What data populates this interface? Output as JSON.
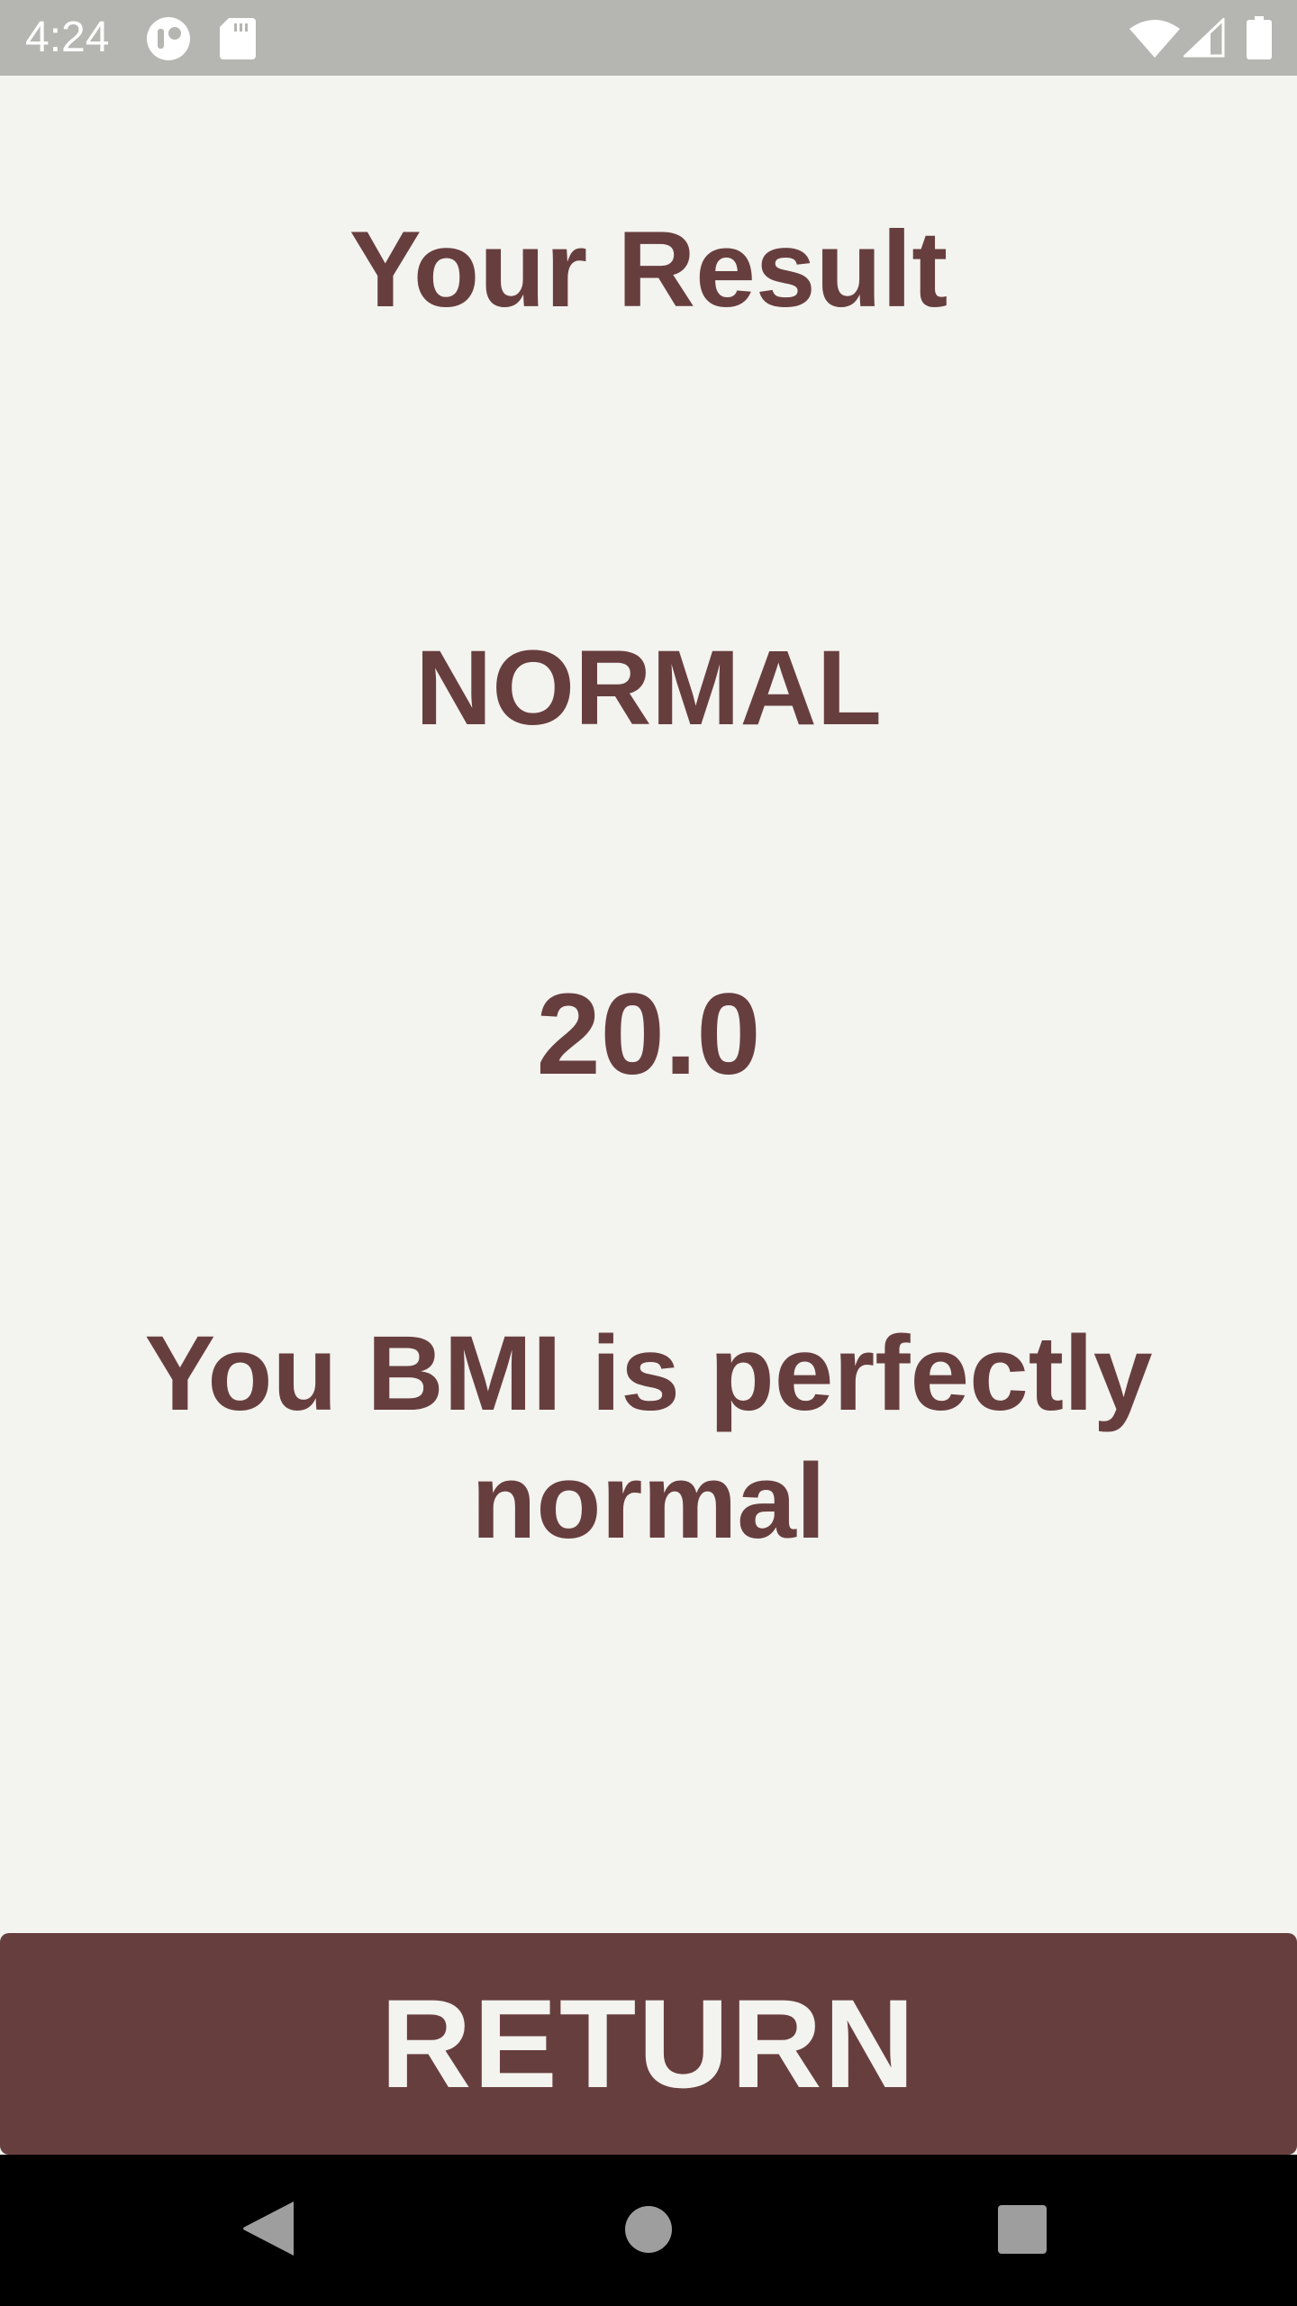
{
  "status_bar": {
    "time": "4:24",
    "icons": [
      "notification-app-icon",
      "sd-card-icon",
      "wifi-icon",
      "cell-signal-icon",
      "battery-icon"
    ]
  },
  "result": {
    "title": "Your Result",
    "status": "NORMAL",
    "bmi_value": "20.0",
    "interpretation": "You BMI is perfectly normal"
  },
  "actions": {
    "return_label": "RETURN"
  },
  "nav_bar": {
    "buttons": [
      "back-icon",
      "home-icon",
      "recents-icon"
    ]
  },
  "colors": {
    "background": "#f3f3ef",
    "accent": "#673e3e",
    "status_bar": "#b5b5b1",
    "nav_bar": "#000000"
  }
}
